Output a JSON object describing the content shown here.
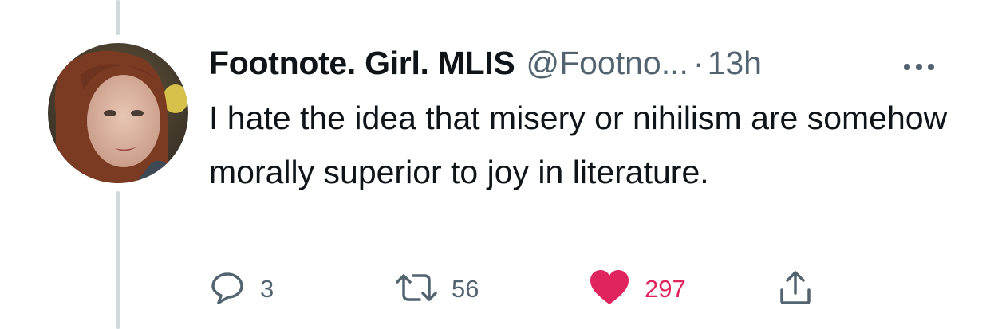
{
  "tweet": {
    "display_name": "Footnote. Girl. MLIS",
    "handle": "@Footno...",
    "separator": "·",
    "time": "13h",
    "text": "I hate the idea that misery or nihilism are somehow morally superior to joy in literature."
  },
  "actions": {
    "reply_count": "3",
    "retweet_count": "56",
    "like_count": "297"
  },
  "icons": {
    "reply": "speech-bubble-icon",
    "retweet": "retweet-arrows-icon",
    "like": "heart-icon",
    "share": "share-upload-icon",
    "more": "more-dots-icon"
  },
  "colors": {
    "text": "#0f1419",
    "secondary": "#536471",
    "like": "#e0245e",
    "thread_line": "#cfd9de"
  }
}
